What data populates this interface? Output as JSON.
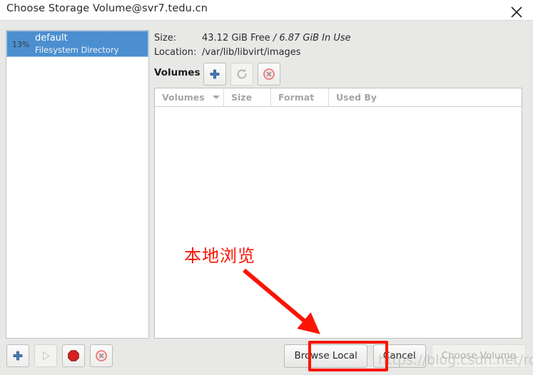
{
  "window": {
    "title": "Choose Storage Volume@svr7.tedu.cn",
    "close_icon": "close-icon"
  },
  "pools": {
    "items": [
      {
        "percent": "13%",
        "name": "default",
        "type": "Filesystem Directory",
        "selected": true
      }
    ],
    "toolbar": [
      {
        "icon": "add-pool-icon",
        "label": "Add Pool",
        "enabled": true
      },
      {
        "icon": "start-pool-icon",
        "label": "Start Pool",
        "enabled": false
      },
      {
        "icon": "stop-pool-icon",
        "label": "Stop Pool",
        "enabled": true
      },
      {
        "icon": "delete-pool-icon",
        "label": "Delete Pool",
        "enabled": true
      }
    ]
  },
  "details": {
    "size_label": "Size:",
    "size_free": "43.12 GiB Free",
    "size_sep": "/",
    "size_inuse": "6.87 GiB In Use",
    "location_label": "Location:",
    "location_value": "/var/lib/libvirt/images"
  },
  "volumes": {
    "section_label": "Volumes",
    "toolbar": [
      {
        "icon": "add-volume-icon",
        "label": "New Volume",
        "enabled": true
      },
      {
        "icon": "refresh-volume-icon",
        "label": "Refresh Volume",
        "enabled": false
      },
      {
        "icon": "delete-volume-icon",
        "label": "Delete Volume",
        "enabled": true
      }
    ],
    "columns": [
      {
        "label": "Volumes",
        "sorted": true
      },
      {
        "label": "Size",
        "sorted": false
      },
      {
        "label": "Format",
        "sorted": false
      },
      {
        "label": "Used By",
        "sorted": false
      }
    ],
    "rows": []
  },
  "actions": {
    "browse_local": "Browse Local",
    "cancel": "Cancel",
    "choose_volume": "Choose Volume",
    "choose_volume_enabled": false
  },
  "annotations": {
    "callout_text": "本地浏览",
    "callout_color": "#fb1405",
    "highlight_color": "#fb1405",
    "watermark": "https://blog.csdn.net/rosigo_"
  },
  "colors": {
    "selection_blue": "#4b8fd0",
    "body_background": "#e8e8e7",
    "titlebar_background": "#ffffff",
    "annotation_red": "#fb1405"
  }
}
